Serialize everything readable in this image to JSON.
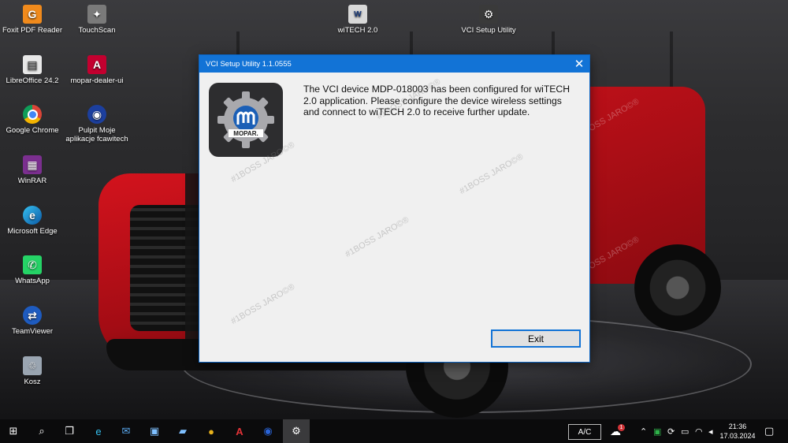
{
  "desktop": {
    "icons": [
      {
        "label": "Foxit PDF Reader",
        "icon": "foxit-pdf-icon",
        "color": "#f08a1c",
        "glyph": "G"
      },
      {
        "label": "TouchScan",
        "icon": "touchscan-icon",
        "color": "#7a7a7a",
        "glyph": "✦"
      },
      {
        "label": "wiTECH 2.0",
        "icon": "witech-icon",
        "color": "#d8d8d8",
        "glyph": "W"
      },
      {
        "label": "VCI Setup Utility",
        "icon": "vci-setup-icon",
        "color": "#3a3a3a",
        "glyph": "⚙"
      },
      {
        "label": "LibreOffice 24.2",
        "icon": "libreoffice-icon",
        "color": "#e8e8e8",
        "glyph": "▤"
      },
      {
        "label": "mopar-dealer-ui",
        "icon": "angular-icon",
        "color": "#c3002f",
        "glyph": "A"
      },
      {
        "label": "Google Chrome",
        "icon": "chrome-icon",
        "color": "#2b8a3e",
        "glyph": "●"
      },
      {
        "label": "Pulpit Moje aplikacje  fcawitech",
        "icon": "mopar-app-icon",
        "color": "#1c3f9e",
        "glyph": "◉"
      },
      {
        "label": "WinRAR",
        "icon": "winrar-icon",
        "color": "#7b2f8f",
        "glyph": "▦"
      },
      {
        "label": "Microsoft Edge",
        "icon": "edge-icon",
        "color": "#1a7fd4",
        "glyph": "e"
      },
      {
        "label": "WhatsApp",
        "icon": "whatsapp-icon",
        "color": "#25d366",
        "glyph": "✆"
      },
      {
        "label": "TeamViewer",
        "icon": "teamviewer-icon",
        "color": "#1e5bbf",
        "glyph": "⇄"
      },
      {
        "label": "Kosz",
        "icon": "recycle-bin-icon",
        "color": "#9aa5b1",
        "glyph": "🗑"
      }
    ],
    "watermarks": [
      "#1BOSS JARO©®",
      "#1BOSS JARO©®",
      "#1BOSS JARO©®",
      "#1BOSS JARO©®",
      "#1BOSS JARO©®",
      "#1BOSS JARO©®",
      "#1BOSS JARO©®"
    ]
  },
  "dialog": {
    "title": "VCI Setup Utility 1.1.0555",
    "close_glyph": "✕",
    "message": "The VCI device MDP-018003 has been configured for wiTECH 2.0 application. Please configure the device wireless settings and connect to wiTECH 2.0 to receive further update.",
    "logo_text": "MOPAR.",
    "exit_label": "Exit",
    "accent": "#1273d6"
  },
  "taskbar": {
    "items": [
      {
        "icon": "start-icon",
        "glyph": "⊞"
      },
      {
        "icon": "search-icon",
        "glyph": "⌕"
      },
      {
        "icon": "task-view-icon",
        "glyph": "❐"
      },
      {
        "icon": "edge-icon",
        "glyph": "e"
      },
      {
        "icon": "mail-icon",
        "glyph": "✉"
      },
      {
        "icon": "remote-desktop-icon",
        "glyph": "▣"
      },
      {
        "icon": "file-explorer-icon",
        "glyph": "▰"
      },
      {
        "icon": "chrome-icon",
        "glyph": "●"
      },
      {
        "icon": "angular-icon",
        "glyph": "A"
      },
      {
        "icon": "mopar-app-icon",
        "glyph": "◉"
      },
      {
        "icon": "vci-setup-icon",
        "glyph": "⚙"
      }
    ],
    "language": "A/C",
    "notification_count": "1",
    "time": "21:36",
    "date": "17.03.2024"
  }
}
